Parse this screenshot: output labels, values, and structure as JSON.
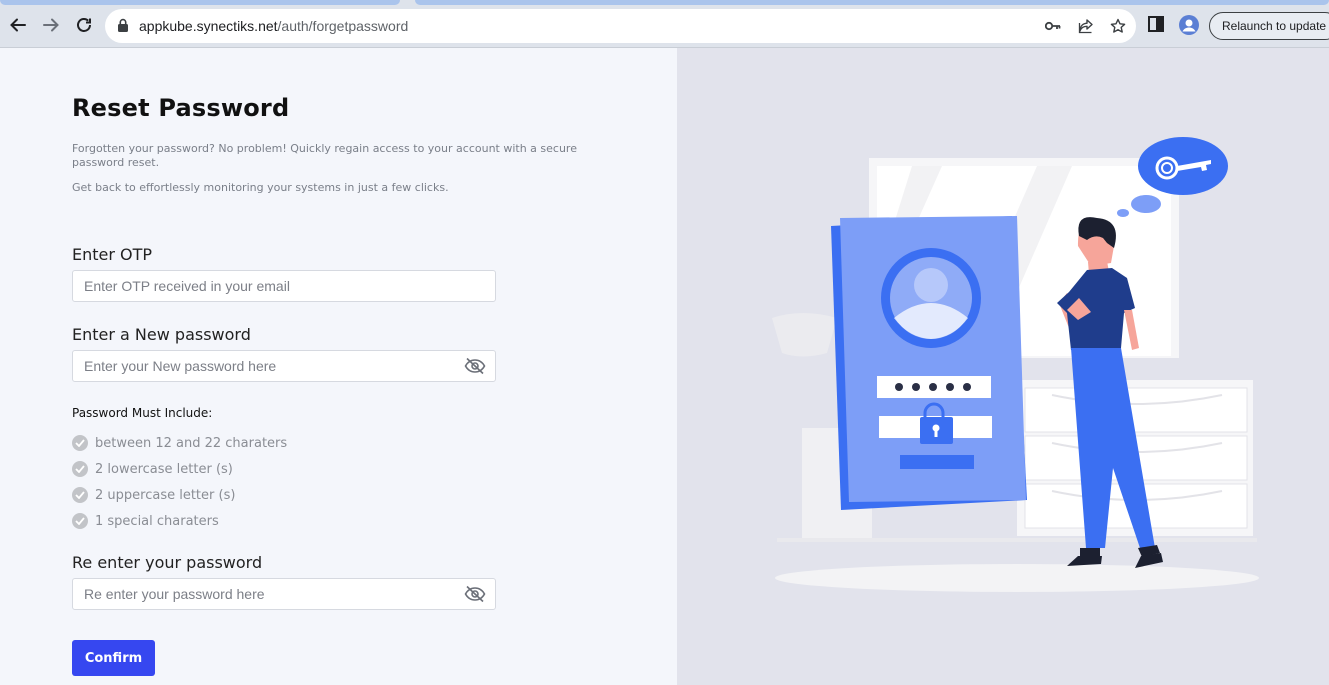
{
  "browser": {
    "url_domain": "appkube.synectiks.net",
    "url_path": "/auth/forgetpassword",
    "relaunch_label": "Relaunch to update"
  },
  "form": {
    "title": "Reset Password",
    "description_1": "Forgotten your password? No problem! Quickly regain access to your account with a secure password reset.",
    "description_2": "Get back to effortlessly monitoring your systems in just a few clicks.",
    "otp_label": "Enter OTP",
    "otp_placeholder": "Enter OTP received in your email",
    "new_password_label": "Enter a New password",
    "new_password_placeholder": "Enter your New password here",
    "requirements_title": "Password Must Include:",
    "requirements": [
      "between 12 and 22 charaters",
      "2 lowercase letter (s)",
      "2 uppercase letter (s)",
      "1 special charaters"
    ],
    "reenter_label": "Re enter your password",
    "reenter_placeholder": "Re enter your password here",
    "confirm_label": "Confirm"
  },
  "colors": {
    "accent": "#3647f0",
    "illustration_blue": "#3b6ff2"
  },
  "icons": {
    "password_visibility": "eye-slash-icon",
    "requirement_check": "check-circle-icon"
  }
}
